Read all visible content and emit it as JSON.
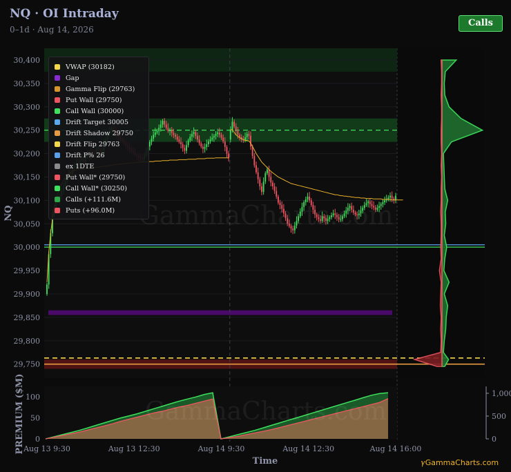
{
  "header": {
    "title": "NQ · OI Intraday",
    "subtitle": "0–1d · Aug 14, 2026",
    "calls_button": "Calls"
  },
  "footer": {
    "brand": "𝛾GammaCharts.com"
  },
  "watermark": "GammaCharts.com",
  "colors": {
    "background": "#0b0b0c",
    "up": "#3ee15c",
    "down": "#ef5560",
    "calls": "#2bd24c",
    "puts": "#ef5560",
    "vwap": "#e8b02a",
    "gap": "#4a0a6a",
    "call_wall_zone": "#13401c",
    "put_wall_zone": "#5a1414"
  },
  "legend": [
    {
      "label": "VWAP (30182)",
      "color": "#f5d84a"
    },
    {
      "label": "Gap",
      "color": "#8a2bd2"
    },
    {
      "label": "Gamma Flip (29763)",
      "color": "#d8962a"
    },
    {
      "label": "Put Wall (29750)",
      "color": "#ef5560"
    },
    {
      "label": "Call Wall (30000)",
      "color": "#3ee15c"
    },
    {
      "label": "Drift Target 30005",
      "color": "#5aa8f0"
    },
    {
      "label": "Drift Shadow 29750",
      "color": "#e89a40"
    },
    {
      "label": "Drift Flip 29763",
      "color": "#f5d84a"
    },
    {
      "label": "Drift P% 26",
      "color": "#5aa0e8"
    },
    {
      "label": "ex 1DTE",
      "color": "#8a8a8a"
    },
    {
      "label": "Put Wall* (29750)",
      "color": "#ef5560"
    },
    {
      "label": "Call Wall* (30250)",
      "color": "#3ee15c"
    },
    {
      "label": "Calls (+111.6M)",
      "color": "#2fa84a"
    },
    {
      "label": "Puts (+96.0M)",
      "color": "#ef5560"
    }
  ],
  "chart_data": [
    {
      "type": "candlestick",
      "ylabel": "NQ",
      "ylim": [
        29720,
        30425
      ],
      "yticks": [
        29750,
        29800,
        29850,
        29900,
        29950,
        30000,
        30050,
        30100,
        30150,
        30200,
        30250,
        30300,
        30350,
        30400
      ],
      "ytick_labels": [
        "29,750",
        "29,800",
        "29,850",
        "29,900",
        "29,950",
        "30,000",
        "30,050",
        "30,100",
        "30,150",
        "30,200",
        "30,250",
        "30,300",
        "30,350",
        "30,400"
      ],
      "session_break_index": 100,
      "close_series": [
        29920,
        29985,
        30030,
        30070,
        30085,
        30095,
        30100,
        30110,
        30120,
        30130,
        30140,
        30150,
        30160,
        30155,
        30170,
        30175,
        30180,
        30172,
        30185,
        30192,
        30182,
        30195,
        30200,
        30190,
        30205,
        30202,
        30198,
        30210,
        30212,
        30195,
        30205,
        30220,
        30230,
        30242,
        30248,
        30255,
        30250,
        30245,
        30240,
        30235,
        30230,
        30228,
        30222,
        30218,
        30214,
        30210,
        30206,
        30202,
        30198,
        30195,
        30192,
        30190,
        30188,
        30196,
        30205,
        30215,
        30225,
        30232,
        30240,
        30245,
        30248,
        30255,
        30262,
        30270,
        30262,
        30255,
        30248,
        30250,
        30244,
        30240,
        30236,
        30230,
        30225,
        30220,
        30212,
        30206,
        30218,
        30228,
        30236,
        30242,
        30246,
        30238,
        30230,
        30222,
        30215,
        30210,
        30214,
        30220,
        30226,
        30230,
        30234,
        30238,
        30242,
        30245,
        30240,
        30234,
        30226,
        30214,
        30200,
        30190,
        30250,
        30268,
        30258,
        30248,
        30240,
        30235,
        30230,
        30228,
        30235,
        30242,
        30238,
        30215,
        30195,
        30175,
        30160,
        30145,
        30130,
        30118,
        30140,
        30158,
        30166,
        30150,
        30138,
        30130,
        30120,
        30108,
        30095,
        30090,
        30082,
        30072,
        30062,
        30050,
        30045,
        30040,
        30036,
        30046,
        30056,
        30066,
        30076,
        30086,
        30096,
        30102,
        30108,
        30100,
        30090,
        30080,
        30070,
        30064,
        30060,
        30056,
        30066,
        30062,
        30056,
        30060,
        30064,
        30068,
        30072,
        30069,
        30064,
        30060,
        30060,
        30066,
        30072,
        30078,
        30084,
        30088,
        30080,
        30074,
        30070,
        30068,
        30072,
        30078,
        30084,
        30090,
        30094,
        30098,
        30092,
        30088,
        30085,
        30080,
        30084,
        30088,
        30092,
        30096,
        30100,
        30102,
        30106,
        30110,
        30104,
        30100,
        30110
      ],
      "vwap_series": [
        29925,
        29990,
        30030,
        30060,
        30085,
        30100,
        30115,
        30125,
        30135,
        30142,
        30150,
        30155,
        30158,
        30160,
        30162,
        30164,
        30165,
        30166,
        30166,
        30166,
        30167,
        30167,
        30168,
        30168,
        30169,
        30170,
        30170,
        30171,
        30171,
        30172,
        30172,
        30173,
        30173,
        30174,
        30174,
        30175,
        30176,
        30176,
        30177,
        30177,
        30178,
        30178,
        30178,
        30179,
        30179,
        30180,
        30180,
        30180,
        30181,
        30181,
        30181,
        30182,
        30182,
        30182,
        30182,
        30183,
        30183,
        30183,
        30183,
        30184,
        30184,
        30184,
        30184,
        30185,
        30185,
        30185,
        30185,
        30186,
        30186,
        30186,
        30186,
        30186,
        30187,
        30187,
        30187,
        30187,
        30187,
        30188,
        30188,
        30188,
        30188,
        30188,
        30189,
        30189,
        30189,
        30189,
        30189,
        30190,
        30190,
        30190,
        30190,
        30190,
        30191,
        30191,
        30191,
        30191,
        30191,
        30191,
        30191,
        30191,
        30250,
        30252,
        30245,
        30240,
        30237,
        30234,
        30232,
        30230,
        30228,
        30228,
        30227,
        30222,
        30215,
        30208,
        30200,
        30194,
        30188,
        30182,
        30178,
        30174,
        30170,
        30166,
        30162,
        30159,
        30156,
        30153,
        30150,
        30148,
        30146,
        30144,
        30142,
        30140,
        30138,
        30136,
        30135,
        30134,
        30133,
        30132,
        30131,
        30130,
        30129,
        30128,
        30127,
        30126,
        30125,
        30124,
        30123,
        30122,
        30121,
        30120,
        30119,
        30118,
        30117,
        30116,
        30115,
        30114,
        30113,
        30112,
        30112,
        30111,
        30110,
        30110,
        30109,
        30109,
        30108,
        30108,
        30107,
        30107,
        30106,
        30106,
        30106,
        30105,
        30105,
        30105,
        30104,
        30104,
        30104,
        30104,
        30103,
        30103,
        30103,
        30103,
        30103,
        30102,
        30102,
        30102,
        30102,
        30102,
        30101,
        30101,
        30101,
        30101,
        30101,
        30101,
        30101
      ],
      "levels": [
        {
          "name": "Call Wall",
          "value": 30000
        },
        {
          "name": "Drift Target",
          "value": 30005
        },
        {
          "name": "Gamma Flip",
          "value": 29763
        },
        {
          "name": "Put Wall",
          "value": 29750
        },
        {
          "name": "Call Wall*",
          "value": 30250
        }
      ],
      "zones": [
        {
          "name": "Call Wall* zone",
          "from": 30225,
          "to": 30275
        },
        {
          "name": "Upper zone",
          "from": 30375,
          "to": 30425
        },
        {
          "name": "Put Wall zone",
          "from": 29740,
          "to": 29760
        },
        {
          "name": "Gap",
          "from": 29855,
          "to": 29865
        }
      ],
      "profile": {
        "levels": [
          29745,
          29760,
          29775,
          29800,
          29825,
          29850,
          29875,
          29900,
          29925,
          29950,
          29975,
          30000,
          30025,
          30050,
          30075,
          30100,
          30125,
          30150,
          30175,
          30200,
          30225,
          30250,
          30275,
          30300,
          30325,
          30350,
          30375,
          30400
        ],
        "calls": [
          6,
          14,
          3,
          5,
          8,
          9,
          12,
          5,
          15,
          4,
          6,
          10,
          5,
          8,
          7,
          12,
          6,
          5,
          4,
          3,
          20,
          85,
          40,
          15,
          6,
          5,
          7,
          30
        ],
        "puts": [
          12,
          65,
          3,
          2,
          3,
          2,
          4,
          3,
          2,
          6,
          2,
          3,
          2,
          2,
          3,
          2,
          2,
          1,
          2,
          1,
          2,
          2,
          1,
          1,
          2,
          1,
          1,
          2
        ],
        "max": 90
      }
    },
    {
      "type": "area",
      "ylabel": "PREMIUM ($M)",
      "xlabel": "Time",
      "left_ylim": [
        0,
        125
      ],
      "left_yticks": [
        0,
        50,
        100
      ],
      "left_ytick_labels": [
        "0",
        "50",
        "100"
      ],
      "right_ylim": [
        0,
        1150
      ],
      "right_yticks": [
        0,
        500,
        1000
      ],
      "right_ytick_labels": [
        "0",
        "500",
        "1,000"
      ],
      "xticks": [
        0,
        50,
        100,
        150,
        200
      ],
      "xtick_labels": [
        "Aug 13 9:30",
        "Aug 13 12:30",
        "Aug 14 9:30",
        "Aug 14 12:30",
        "Aug 14 16:00"
      ],
      "series": [
        {
          "name": "Calls (+111.6M)",
          "values": [
            0,
            5,
            10,
            15,
            20,
            26,
            32,
            38,
            44,
            50,
            55,
            60,
            66,
            72,
            78,
            84,
            90,
            95,
            100,
            106,
            110,
            0,
            5,
            10,
            15,
            20,
            26,
            32,
            38,
            44,
            50,
            56,
            62,
            68,
            74,
            80,
            86,
            92,
            98,
            104,
            108,
            110
          ]
        },
        {
          "name": "Puts (+96.0M)",
          "values": [
            0,
            4,
            8,
            12,
            16,
            21,
            26,
            31,
            36,
            42,
            47,
            52,
            57,
            62,
            66,
            71,
            76,
            80,
            85,
            90,
            95,
            0,
            3,
            6,
            10,
            14,
            18,
            22,
            27,
            32,
            37,
            42,
            47,
            52,
            57,
            62,
            67,
            72,
            77,
            82,
            87,
            96
          ]
        }
      ]
    }
  ]
}
